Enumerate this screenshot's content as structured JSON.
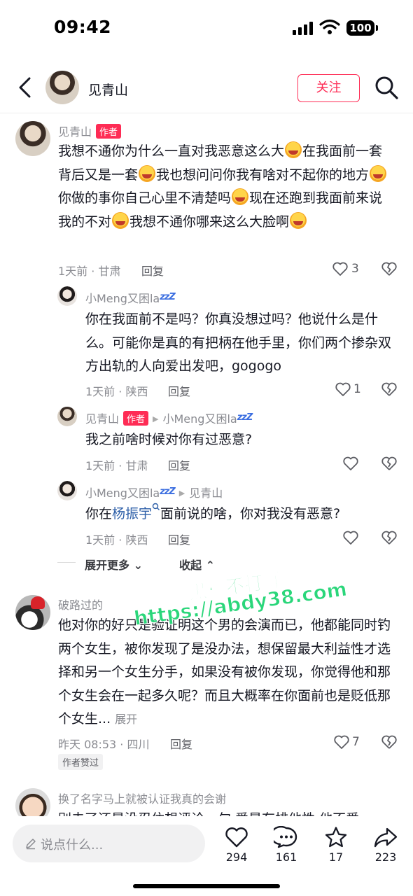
{
  "status_bar": {
    "time": "09:42",
    "battery": "100"
  },
  "header": {
    "author_name": "见青山",
    "follow_label": "关注"
  },
  "comments": [
    {
      "user": "见青山",
      "author_tag": "作者",
      "text_parts": [
        "我想不通你为什么一直对我恶意这么大",
        "在我面前一套背后又是一套",
        "我也想问问你我有啥对不起你的地方",
        "你做的事你自己心里不清楚吗",
        "现在还跑到我面前来说我的不对",
        "我想不通你哪来这么大脸啊"
      ],
      "meta": "1天前 · 甘肃",
      "reply": "回复",
      "likes": "3"
    },
    {
      "user": "小Meng又困la",
      "text": "你在我面前不是吗？你真没想过吗？他说什么是什么。可能你是真的有把柄在他手里，你们两个掺杂双方出轨的人向爱出发吧，gogogo",
      "meta": "1天前 · 陕西",
      "reply": "回复",
      "likes": "1"
    },
    {
      "user": "见青山",
      "author_tag": "作者",
      "reply_to": "小Meng又困la",
      "text": "我之前啥时候对你有过恶意?",
      "meta": "1天前 · 甘肃",
      "reply": "回复"
    },
    {
      "user": "小Meng又困la",
      "reply_to": "见青山",
      "text_before": "你在",
      "link": "杨振宇",
      "text_after": "面前说的啥，你对我没有恶意?",
      "meta": "1天前 · 陕西",
      "reply": "回复"
    },
    {
      "user": "破路过的",
      "text": "他对你的好只是验证明这个男的会演而已，他都能同时钓两个女生，被你发现了是没办法，想保留最大利益性才选择和另一个女生分手，如果没有被你发现，你觉得他和那个女生会在一起多久呢？而且大概率在你面前也是贬低那个女生...",
      "more": "展开",
      "meta": "昨天 08:53 · 四川",
      "reply": "回复",
      "likes": "7",
      "badge": "作者赞过"
    },
    {
      "user": "换了名字马上就被认证我真的会谢",
      "text": "别去了还是没忍住想评论一句 爱是有排他性 他不爱"
    }
  ],
  "thread_controls": {
    "expand": "展开更多",
    "collapse": "收起"
  },
  "watermark": {
    "line1": "黑料不打烊",
    "line2": "https://abdy38.com"
  },
  "bottom_bar": {
    "placeholder": "说点什么...",
    "like_count": "294",
    "comment_count": "161",
    "favorite_count": "17",
    "share_count": "223"
  },
  "colors": {
    "accent": "#fe2c55",
    "link": "#2d5fa8",
    "watermark": "#2ad67a"
  }
}
